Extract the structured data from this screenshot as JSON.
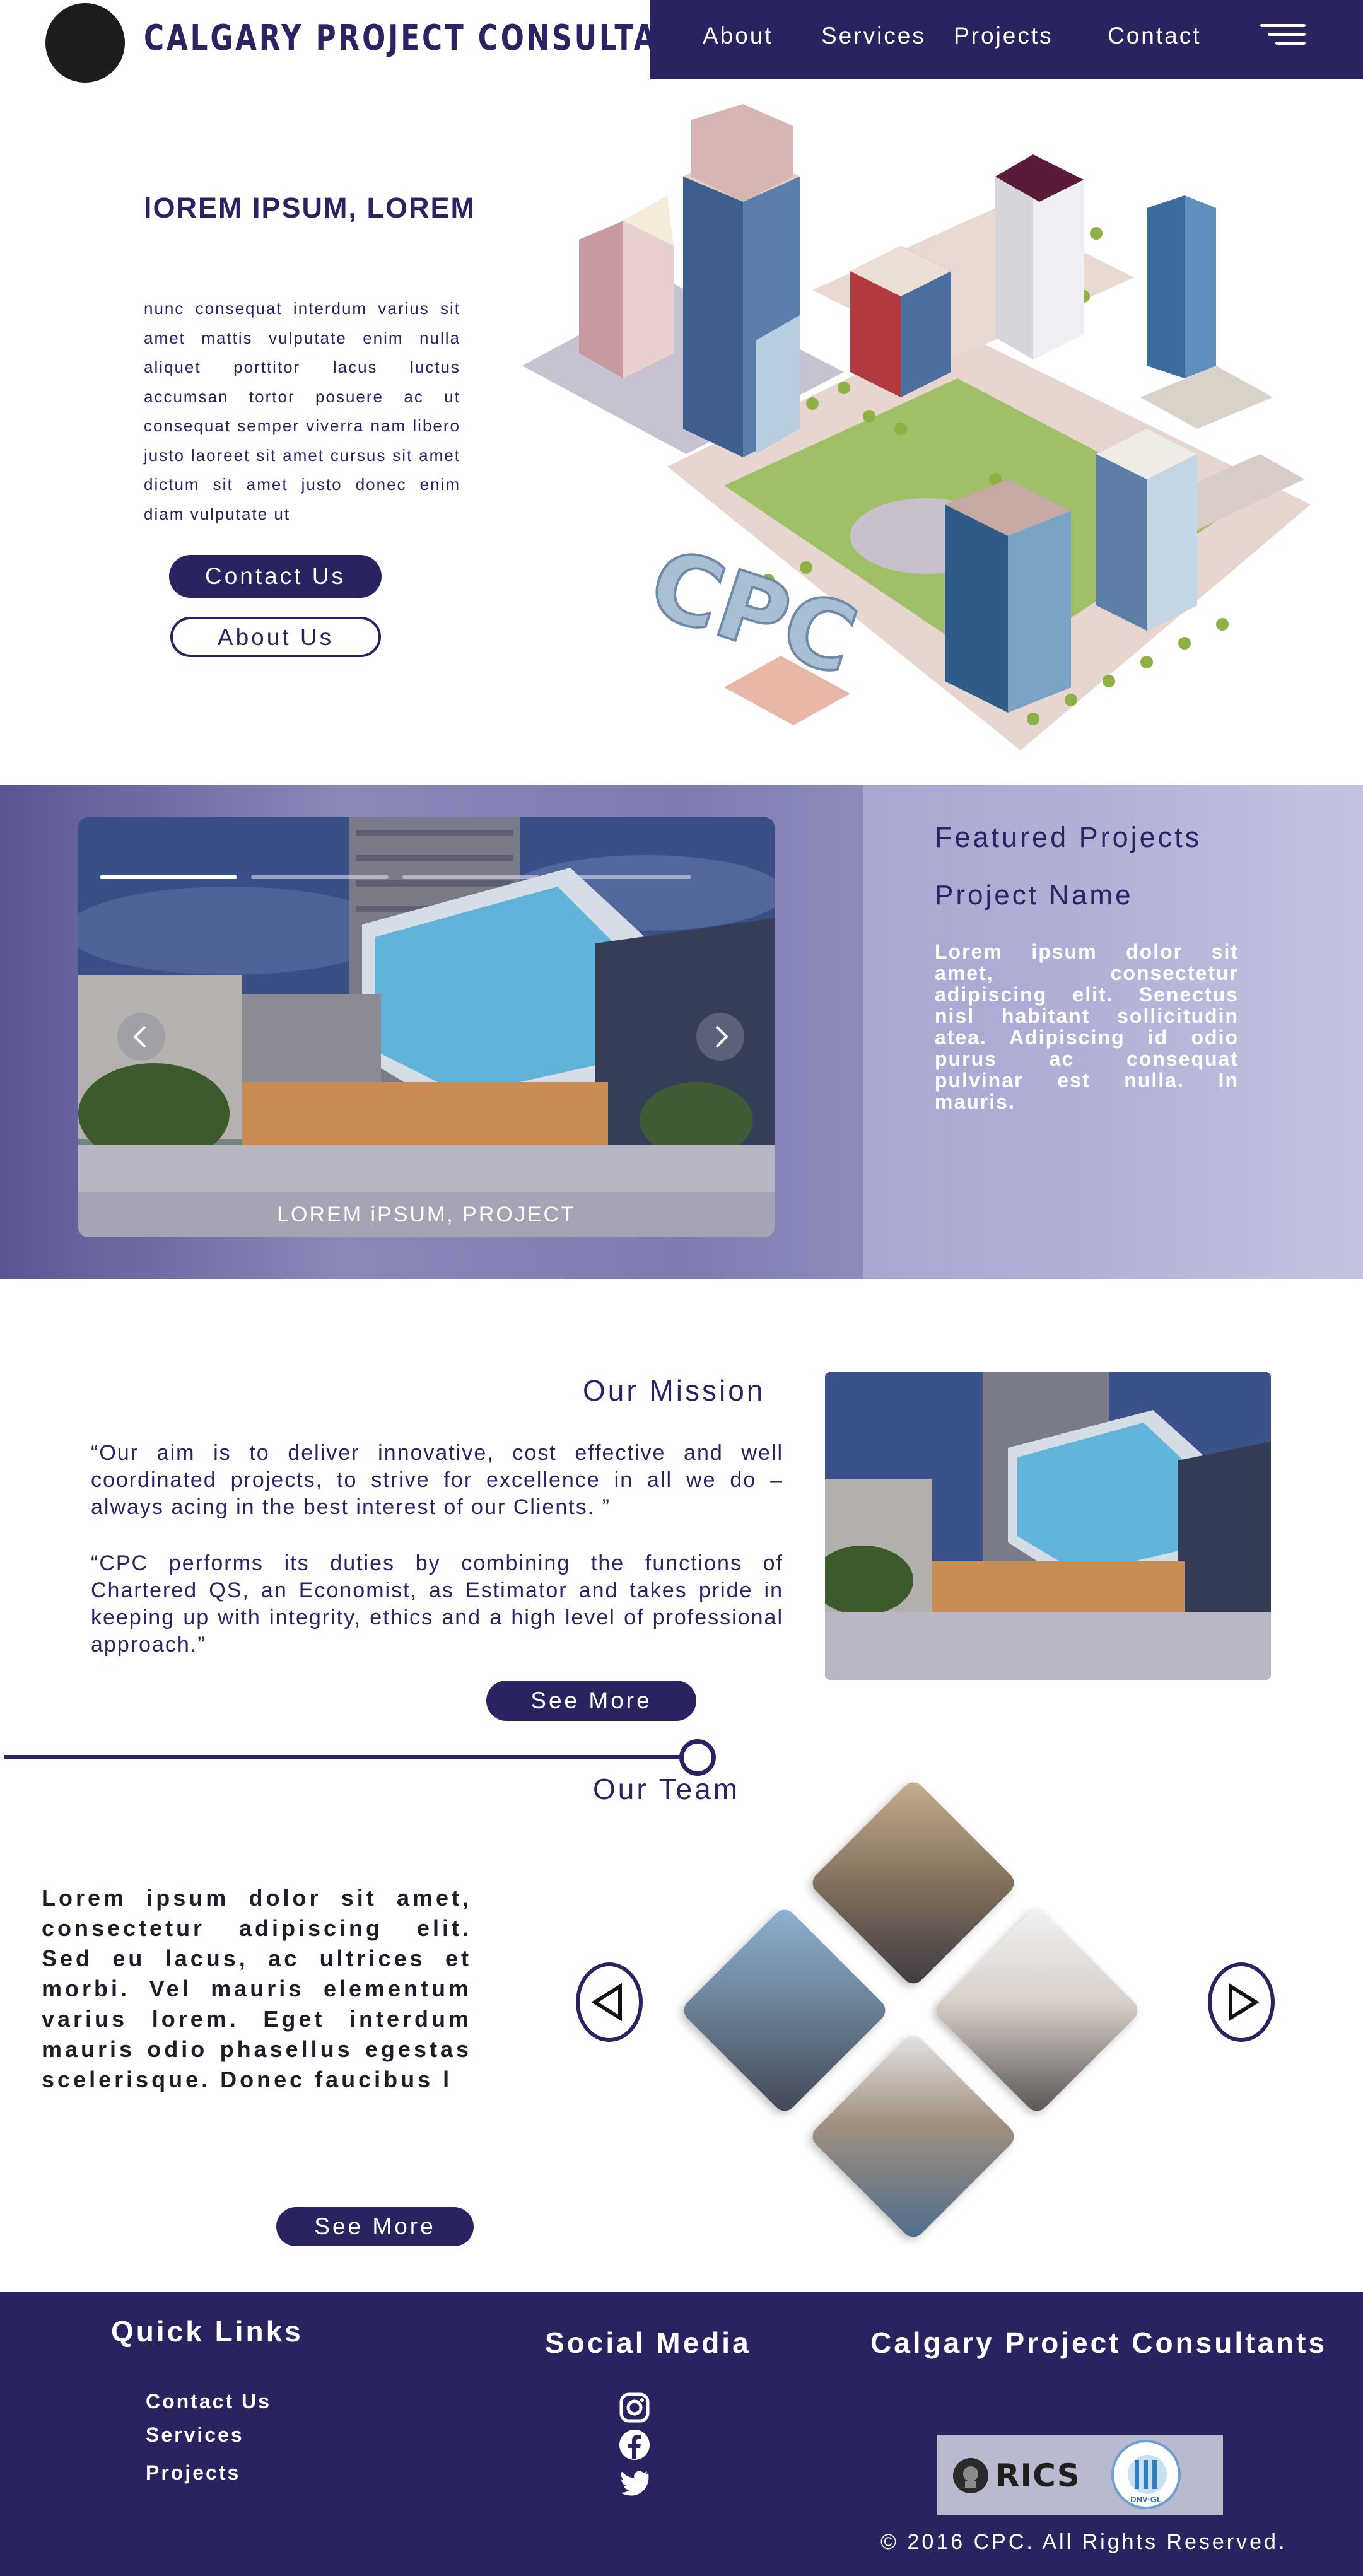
{
  "header": {
    "brand": "CALGARY PROJECT CONSULTANTS",
    "nav": [
      "About",
      "Services",
      "Projects",
      "Contact"
    ],
    "menu_icon": "hamburger-icon"
  },
  "hero": {
    "title": "lOREM IPSUM, LOREM",
    "text": "nunc consequat interdum varius sit amet mattis vulputate enim nulla aliquet porttitor lacus luctus accumsan tortor posuere ac ut consequat semper viverra nam libero justo laoreet sit amet cursus sit amet dictum sit amet justo donec enim diam vulputate ut",
    "contact_label": "Contact Us",
    "about_label": "About Us",
    "illustration_sign": "CPC"
  },
  "featured": {
    "heading": "Featured Projects",
    "project_name": "Project Name",
    "description": "Lorem ipsum dolor sit amet, consectetur adipiscing elit. Senectus nisl habitant sollicitudin atea. Adipiscing id odio purus ac consequat pulvinar est nulla. In mauris.",
    "slide_caption": "LOREM iPSUM, PROJECT",
    "slide_count": 4,
    "active_slide": 1
  },
  "mission": {
    "title": "Our Mission",
    "quote1": "“Our aim is to deliver innovative, cost effective and well coordinated projects, to strive for excellence in all we do – always acing in the best interest of our Clients. ”",
    "quote2": "“CPC performs its duties by combining the functions of Chartered QS, an Economist, as Estimator and takes pride in keeping up with integrity, ethics and a high level of professional approach.”",
    "see_more": "See More"
  },
  "team": {
    "title": "Our Team",
    "text": "Lorem ipsum dolor sit amet, consectetur adipiscing elit. Sed eu lacus, ac ultrices et morbi. Vel mauris elementum varius lorem. Eget interdum mauris odio phasellus egestas scelerisque. Donec faucibus l",
    "see_more": "See More"
  },
  "footer": {
    "quick_links_title": "Quick Links",
    "quick_links": [
      "Contact Us",
      "Services",
      "Projects"
    ],
    "social_title": "Social Media",
    "social_icons": [
      "instagram-icon",
      "facebook-icon",
      "twitter-icon"
    ],
    "company_title": "Calgary Project Consultants",
    "badge_rics": "RICS",
    "badge_dnv": "DNV·GL",
    "copyright": "© 2016 CPC. All Rights Reserved."
  },
  "colors": {
    "primary": "#29235f",
    "text": "#2a2462",
    "white": "#ffffff"
  }
}
